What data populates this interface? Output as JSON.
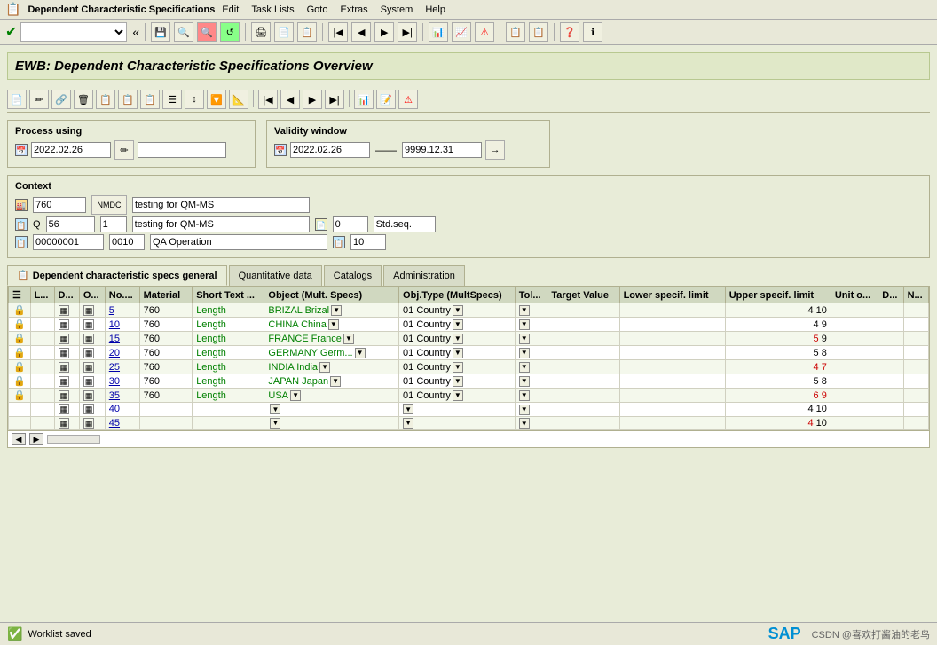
{
  "titleBar": {
    "appIcon": "📋",
    "appTitle": "Dependent Characteristic Specifications",
    "menus": [
      "Edit",
      "Task Lists",
      "Goto",
      "Extras",
      "System",
      "Help"
    ]
  },
  "toolbar": {
    "selectValue": "",
    "selectPlaceholder": ""
  },
  "pageTitle": "EWB: Dependent Characteristic Specifications Overview",
  "processUsing": {
    "label": "Process using",
    "date": "2022.02.26"
  },
  "validityWindow": {
    "label": "Validity window",
    "from": "2022.02.26",
    "arrow": "——",
    "to": "9999.12.31"
  },
  "context": {
    "label": "Context",
    "row1": {
      "icon": "🔧",
      "val1": "760",
      "btn": "NMDC",
      "desc": "testing for QM-MS"
    },
    "row2": {
      "prefix": "Q",
      "val1": "56",
      "val2": "1",
      "desc": "testing for QM-MS",
      "iconSmall": "📋",
      "num": "0",
      "suffix": "Std.seq."
    },
    "row3": {
      "val1": "00000001",
      "val2": "0010",
      "desc": "QA Operation",
      "iconSmall": "📋",
      "num": "10"
    }
  },
  "tabs": [
    {
      "id": "dep-char",
      "label": "Dependent characteristic specs general",
      "icon": "📋",
      "active": true
    },
    {
      "id": "quant",
      "label": "Quantitative data",
      "active": false
    },
    {
      "id": "catalogs",
      "label": "Catalogs",
      "active": false
    },
    {
      "id": "admin",
      "label": "Administration",
      "active": false
    }
  ],
  "table": {
    "columns": [
      "",
      "L...",
      "D...",
      "O...",
      "No....",
      "Material",
      "Short Text ...",
      "Object (Mult. Specs)",
      "Obj.Type (MultSpecs)",
      "Tol...",
      "Target Value",
      "Lower specif. limit",
      "Upper specif. limit",
      "Unit o...",
      "D...",
      "N..."
    ],
    "rows": [
      {
        "lock": true,
        "l": "",
        "d": "🔲",
        "o": "🔲",
        "no": "5",
        "material": "760",
        "shortText": "Length",
        "object": "BRIZAL Brizal",
        "objType": "01 Country",
        "tol": "",
        "target": "",
        "lower": "",
        "upper": "4",
        "upperRed": false,
        "upperVal2": "10",
        "unit": "",
        "d2": "",
        "n": ""
      },
      {
        "lock": true,
        "l": "",
        "d": "🔲",
        "o": "🔲",
        "no": "10",
        "material": "760",
        "shortText": "Length",
        "object": "CHINA China",
        "objType": "01 Country",
        "tol": "",
        "target": "",
        "lower": "",
        "upper": "4",
        "upperRed": false,
        "upperVal2": "9",
        "unit": "",
        "d2": "",
        "n": ""
      },
      {
        "lock": true,
        "l": "",
        "d": "🔲",
        "o": "🔲",
        "no": "15",
        "material": "760",
        "shortText": "Length",
        "object": "FRANCE France",
        "objType": "01 Country",
        "tol": "",
        "target": "",
        "lower": "",
        "upper": "5",
        "upperRed": true,
        "upperVal2": "9",
        "unit": "",
        "d2": "",
        "n": ""
      },
      {
        "lock": true,
        "l": "",
        "d": "🔲",
        "o": "🔲",
        "no": "20",
        "material": "760",
        "shortText": "Length",
        "object": "GERMANY Germ...",
        "objType": "01 Country",
        "tol": "",
        "target": "",
        "lower": "",
        "upper": "5",
        "upperRed": false,
        "upperVal2": "8",
        "unit": "",
        "d2": "",
        "n": ""
      },
      {
        "lock": true,
        "l": "",
        "d": "🔲",
        "o": "🔲",
        "no": "25",
        "material": "760",
        "shortText": "Length",
        "object": "INDIA India",
        "objType": "01 Country",
        "tol": "",
        "target": "",
        "lower": "",
        "upper": "4",
        "upperRed": true,
        "upperVal2": "7",
        "upperVal2Red": true,
        "unit": "",
        "d2": "",
        "n": ""
      },
      {
        "lock": true,
        "l": "",
        "d": "🔲",
        "o": "🔲",
        "no": "30",
        "material": "760",
        "shortText": "Length",
        "object": "JAPAN Japan",
        "objType": "01 Country",
        "tol": "",
        "target": "",
        "lower": "",
        "upper": "5",
        "upperRed": false,
        "upperVal2": "8",
        "unit": "",
        "d2": "",
        "n": ""
      },
      {
        "lock": true,
        "l": "",
        "d": "🔲",
        "o": "🔲",
        "no": "35",
        "material": "760",
        "shortText": "Length",
        "object": "USA",
        "objType": "01 Country",
        "tol": "",
        "target": "",
        "lower": "",
        "upper": "6",
        "upperRed": true,
        "upperVal2": "9",
        "upperVal2Red": true,
        "unit": "",
        "d2": "",
        "n": ""
      },
      {
        "lock": false,
        "l": "",
        "d": "🔲",
        "o": "🔲",
        "no": "40",
        "material": "",
        "shortText": "",
        "object": "",
        "objType": "",
        "tol": "",
        "target": "",
        "lower": "",
        "upper": "4",
        "upperRed": false,
        "upperVal2": "10",
        "unit": "",
        "d2": "",
        "n": ""
      },
      {
        "lock": false,
        "l": "",
        "d": "🔲",
        "o": "🔲",
        "no": "45",
        "material": "",
        "shortText": "",
        "object": "",
        "objType": "",
        "tol": "",
        "target": "",
        "lower": "",
        "upper": "4",
        "upperRed": true,
        "upperVal2": "10",
        "unit": "",
        "d2": "",
        "n": ""
      }
    ]
  },
  "statusBar": {
    "icon": "✅",
    "message": "Worklist saved",
    "sapLogo": "SAP",
    "watermark": "CSDN @喜欢打酱油的老鸟"
  }
}
